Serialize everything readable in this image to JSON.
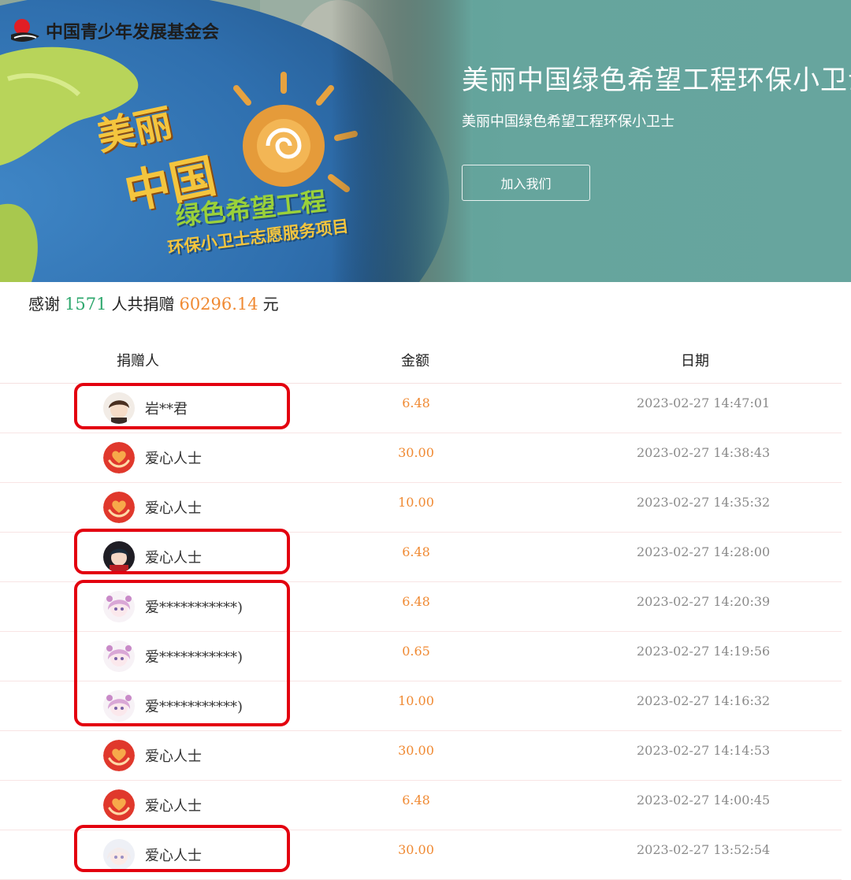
{
  "banner": {
    "org_name": "中国青少年发展基金会",
    "title": "美丽中国绿色希望工程环保小卫士",
    "subtitle": "美丽中国绿色希望工程环保小卫士",
    "join_button": "加入我们",
    "art_text": {
      "line1": "美丽",
      "line2": "中国",
      "line3": "绿色希望工程",
      "line4": "环保小卫士志愿服务项目"
    }
  },
  "summary": {
    "prefix": "感谢",
    "count": "1571",
    "middle": "人共捐赠",
    "amount": "60296.14",
    "suffix": "元"
  },
  "table": {
    "headers": {
      "donor": "捐赠人",
      "amount": "金额",
      "date": "日期"
    },
    "rows": [
      {
        "name": "岩**君",
        "amount": "6.48",
        "date": "2023-02-27 14:47:01",
        "avatar": "anime-boy-brown-hair"
      },
      {
        "name": "爱心人士",
        "amount": "30.00",
        "date": "2023-02-27 14:38:43",
        "avatar": "heart-hands-icon"
      },
      {
        "name": "爱心人士",
        "amount": "10.00",
        "date": "2023-02-27 14:35:32",
        "avatar": "heart-hands-icon"
      },
      {
        "name": "爱心人士",
        "amount": "6.48",
        "date": "2023-02-27 14:28:00",
        "avatar": "anime-boy-dark-red"
      },
      {
        "name": "爱***********)",
        "amount": "6.48",
        "date": "2023-02-27 14:20:39",
        "avatar": "anime-girl-pink-hair"
      },
      {
        "name": "爱***********)",
        "amount": "0.65",
        "date": "2023-02-27 14:19:56",
        "avatar": "anime-girl-pink-hair"
      },
      {
        "name": "爱***********)",
        "amount": "10.00",
        "date": "2023-02-27 14:16:32",
        "avatar": "anime-girl-pink-hair"
      },
      {
        "name": "爱心人士",
        "amount": "30.00",
        "date": "2023-02-27 14:14:53",
        "avatar": "heart-hands-icon"
      },
      {
        "name": "爱心人士",
        "amount": "6.48",
        "date": "2023-02-27 14:00:45",
        "avatar": "heart-hands-icon"
      },
      {
        "name": "爱心人士",
        "amount": "30.00",
        "date": "2023-02-27 13:52:54",
        "avatar": "anime-girl-white-hair"
      }
    ]
  },
  "colors": {
    "banner_bg": "#66a59d",
    "count_green": "#2fa86e",
    "amount_orange": "#f08a33",
    "date_gray": "#8a8a8a",
    "highlight_red": "#e3000f"
  }
}
